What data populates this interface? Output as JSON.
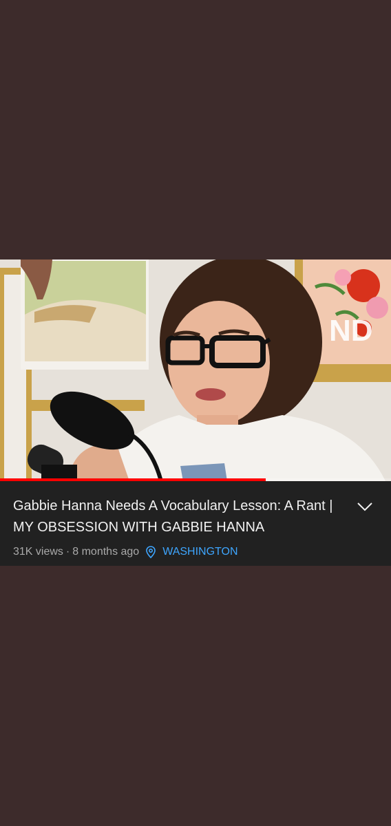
{
  "video": {
    "progress_fraction": 0.68,
    "colors": {
      "progress": "#ff0000",
      "background": "#3d2b2b",
      "panel": "#212121",
      "link": "#3ea6ff"
    }
  },
  "info": {
    "title": "Gabbie Hanna Needs A Vocabulary Lesson: A Rant | MY OBSESSION WITH GABBIE HANNA",
    "views": "31K views",
    "separator": "·",
    "age": "8 months ago",
    "location": "WASHINGTON",
    "location_icon": "location-pin-icon",
    "expand_icon": "chevron-down-icon"
  }
}
